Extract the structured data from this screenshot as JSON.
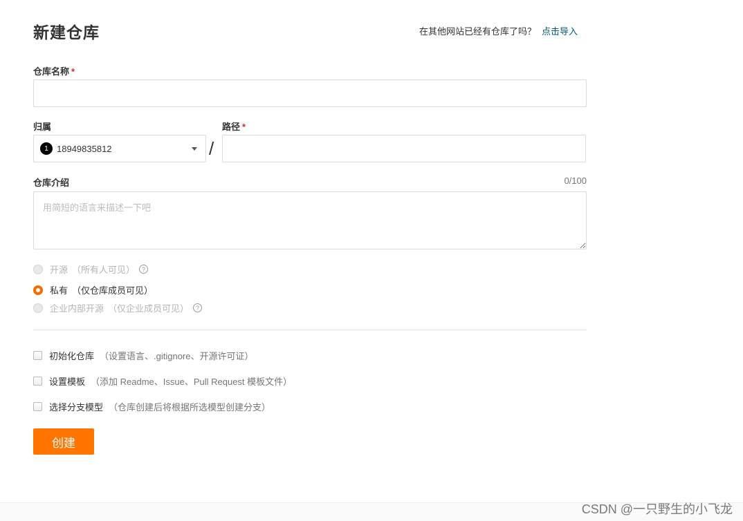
{
  "header": {
    "title": "新建仓库",
    "import_prompt": "在其他网站已经有仓库了吗？",
    "import_link": "点击导入"
  },
  "form": {
    "repo_name": {
      "label": "仓库名称",
      "required_mark": "*",
      "value": ""
    },
    "owner": {
      "label": "归属",
      "avatar_text": "1",
      "selected": "18949835812"
    },
    "separator": "/",
    "path": {
      "label": "路径",
      "required_mark": "*",
      "value": ""
    },
    "description": {
      "label": "仓库介绍",
      "counter": "0/100",
      "placeholder": "用简短的语言来描述一下吧",
      "value": ""
    },
    "visibility": [
      {
        "label": "开源",
        "hint": "（所有人可见）",
        "help": "?",
        "state": "disabled"
      },
      {
        "label": "私有",
        "hint": "（仅仓库成员可见）",
        "help": "",
        "state": "checked"
      },
      {
        "label": "企业内部开源",
        "hint": "（仅企业成员可见）",
        "help": "?",
        "state": "disabled"
      }
    ],
    "options": [
      {
        "label": "初始化仓库",
        "hint": "（设置语言、.gitignore、开源许可证）",
        "checked": false
      },
      {
        "label": "设置模板",
        "hint": "（添加 Readme、Issue、Pull Request 模板文件）",
        "checked": false
      },
      {
        "label": "选择分支模型",
        "hint": "（仓库创建后将根据所选模型创建分支）",
        "checked": false
      }
    ],
    "submit_label": "创建"
  },
  "watermark": "CSDN @一只野生的小飞龙",
  "colors": {
    "accent": "#ff7500",
    "link": "#005980",
    "required": "#db2828"
  }
}
